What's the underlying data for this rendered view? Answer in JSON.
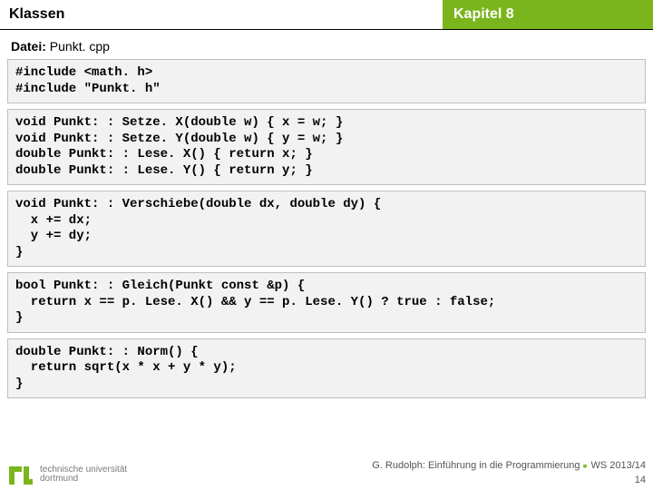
{
  "header": {
    "left": "Klassen",
    "right": "Kapitel 8"
  },
  "subtitle": {
    "label": "Datei:",
    "value": "Punkt. cpp"
  },
  "code": {
    "block1": "#include <math. h>\n#include \"Punkt. h\"",
    "block2": "void Punkt: : Setze. X(double w) { x = w; }\nvoid Punkt: : Setze. Y(double w) { y = w; }\ndouble Punkt: : Lese. X() { return x; }\ndouble Punkt: : Lese. Y() { return y; }",
    "block3": "void Punkt: : Verschiebe(double dx, double dy) {\n  x += dx;\n  y += dy;\n}",
    "block4": "bool Punkt: : Gleich(Punkt const &p) {\n  return x == p. Lese. X() && y == p. Lese. Y() ? true : false;\n}",
    "block5": "double Punkt: : Norm() {\n  return sqrt(x * x + y * y);\n}"
  },
  "footer": {
    "logo_top": "technische universität",
    "logo_bottom": "dortmund",
    "author": "G. Rudolph: Einführung in die Programmierung",
    "term": "WS 2013/14",
    "page": "14"
  }
}
